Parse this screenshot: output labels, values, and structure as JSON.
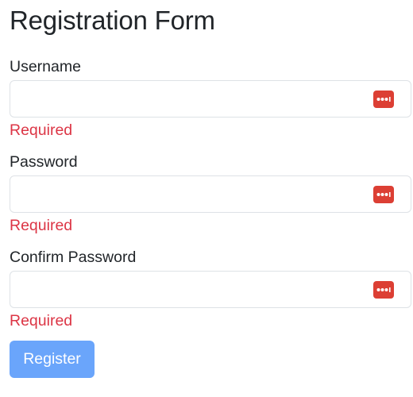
{
  "form": {
    "title": "Registration Form",
    "fields": [
      {
        "label": "Username",
        "value": "",
        "error": "Required"
      },
      {
        "label": "Password",
        "value": "",
        "error": "Required"
      },
      {
        "label": "Confirm Password",
        "value": "",
        "error": "Required"
      }
    ],
    "submit_label": "Register"
  },
  "icons": {
    "field_icon": "password-manager-icon"
  },
  "colors": {
    "error": "#dc3545",
    "icon_badge": "#dc3f34",
    "button_disabled": "#6aa5fb",
    "input_border": "#dee2e6"
  }
}
